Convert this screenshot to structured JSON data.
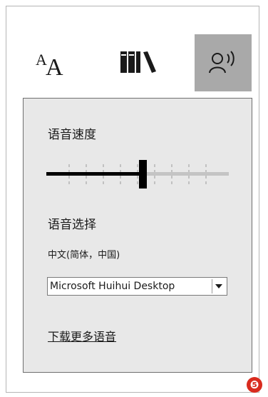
{
  "toolbar": {
    "items": [
      {
        "icon": "text-size-icon",
        "glyph_a_small": "A",
        "glyph_a_large": "A",
        "active": false
      },
      {
        "icon": "books-icon",
        "active": false
      },
      {
        "icon": "read-aloud-icon",
        "active": true
      }
    ]
  },
  "speech": {
    "speed_label": "语音速度",
    "speed_level": 0.53,
    "speed_ticks": 9,
    "voice_label": "语音选择",
    "language_label": "中文(简体，中国)",
    "voice_selected": "Microsoft Huihui Desktop",
    "more_voices_link": "下载更多语音"
  },
  "badge": {
    "text": "❺"
  },
  "colors": {
    "active_tab": "#a9a9a9",
    "panel_bg": "#e8e8e8",
    "slider_filled": "#000000",
    "slider_track": "#c4c4c4",
    "badge": "#d92b1e"
  }
}
